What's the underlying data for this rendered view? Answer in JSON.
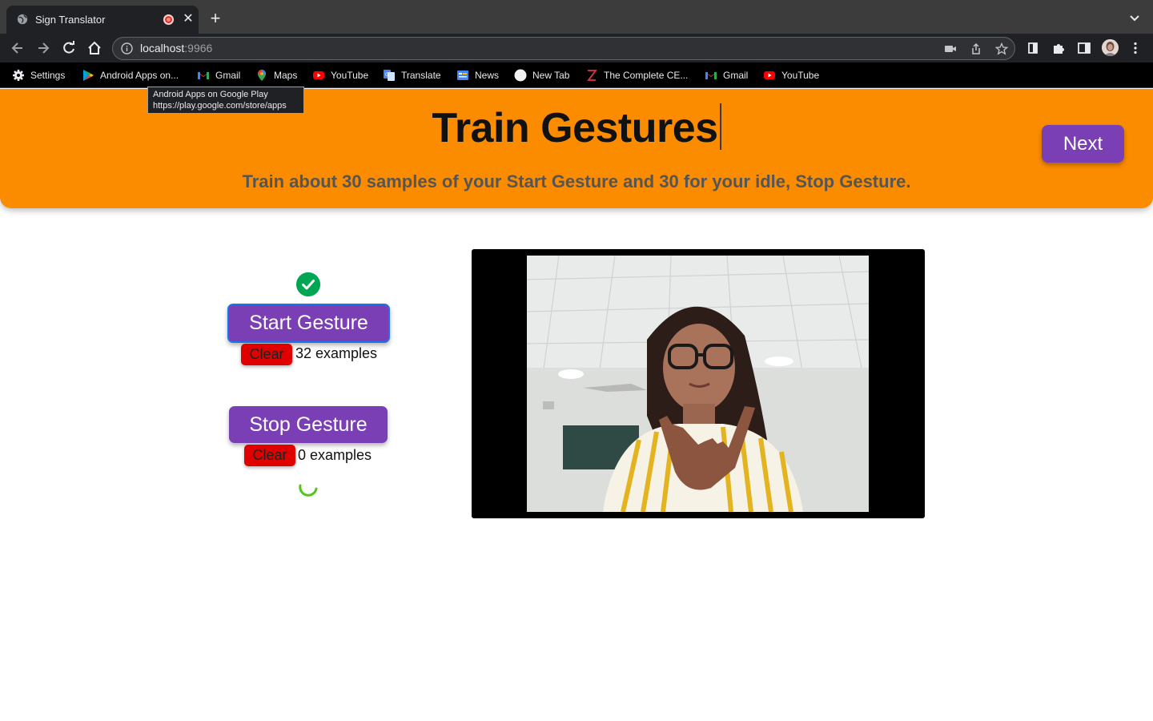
{
  "browser": {
    "tab_title": "Sign Translator",
    "url_host": "localhost",
    "url_port": ":9966",
    "bookmarks": [
      {
        "label": "Settings",
        "icon": "gear-icon"
      },
      {
        "label": "Android Apps on...",
        "icon": "google-play-icon"
      },
      {
        "label": "Gmail",
        "icon": "gmail-icon"
      },
      {
        "label": "Maps",
        "icon": "maps-icon"
      },
      {
        "label": "YouTube",
        "icon": "youtube-icon"
      },
      {
        "label": "Translate",
        "icon": "translate-icon"
      },
      {
        "label": "News",
        "icon": "news-icon"
      },
      {
        "label": "New Tab",
        "icon": "globe-icon"
      },
      {
        "label": "The Complete CE...",
        "icon": "zomato-icon"
      },
      {
        "label": "Gmail",
        "icon": "gmail-icon"
      },
      {
        "label": "YouTube",
        "icon": "youtube-icon"
      }
    ],
    "tooltip": {
      "title": "Android Apps on Google Play",
      "url": "https://play.google.com/store/apps"
    }
  },
  "header": {
    "title": "Train Gestures",
    "subtitle": "Train about 30 samples of your Start Gesture and 30 for your idle, Stop Gesture.",
    "next_label": "Next"
  },
  "training": {
    "start": {
      "label": "Start Gesture",
      "clear_label": "Clear",
      "count_text": "32 examples",
      "done": true
    },
    "stop": {
      "label": "Stop Gesture",
      "clear_label": "Clear",
      "count_text": "0 examples",
      "loading": true
    }
  },
  "colors": {
    "header_bg": "#fb8c00",
    "button_purple": "#7b3fb5",
    "clear_red": "#e00000",
    "check_green": "#00a651"
  }
}
